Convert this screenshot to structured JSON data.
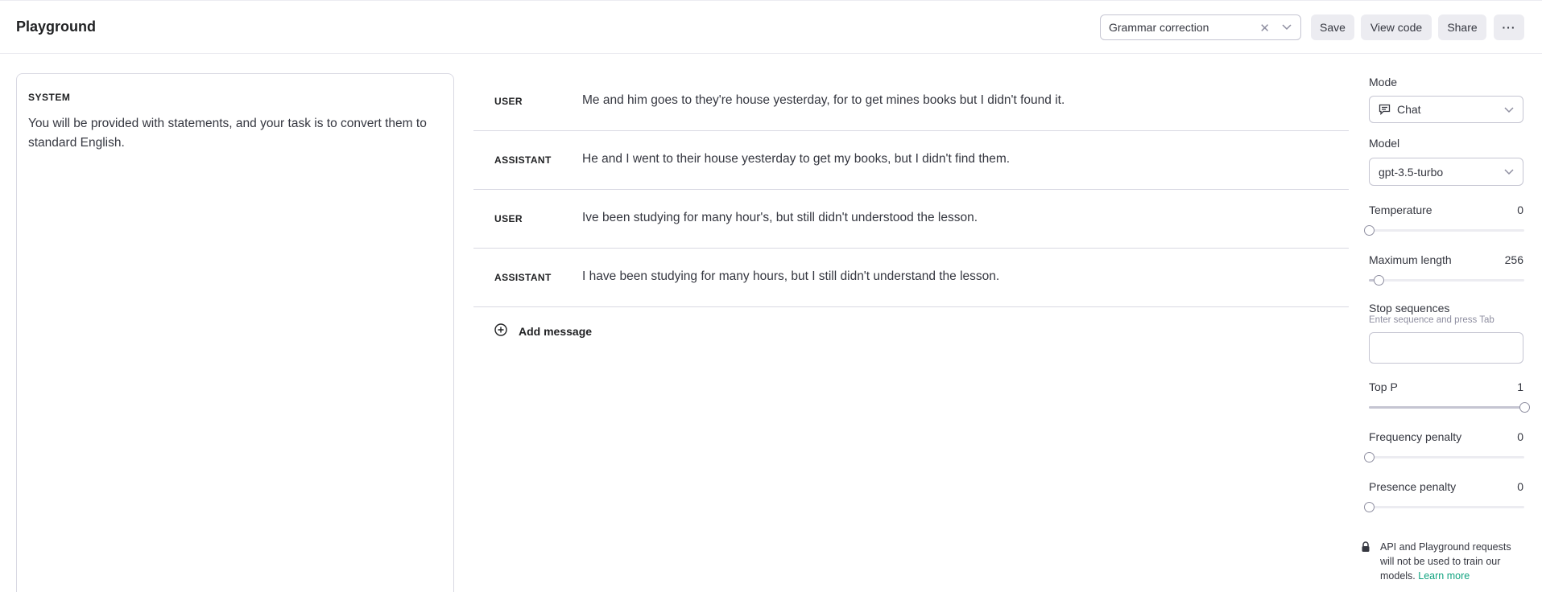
{
  "header": {
    "title": "Playground",
    "preset": "Grammar correction",
    "save_label": "Save",
    "view_code_label": "View code",
    "share_label": "Share",
    "more_label": "···"
  },
  "system": {
    "label": "SYSTEM",
    "text": "You will be provided with statements, and your task is to convert them to standard English."
  },
  "messages": [
    {
      "role": "USER",
      "content": "Me and him goes to they're house yesterday, for to get mines books but I didn't found it."
    },
    {
      "role": "ASSISTANT",
      "content": "He and I went to their house yesterday to get my books, but I didn't find them."
    },
    {
      "role": "USER",
      "content": "Ive been studying for many hour's, but still didn't understood the lesson."
    },
    {
      "role": "ASSISTANT",
      "content": "I have been studying for many hours, but I still didn't understand the lesson."
    }
  ],
  "add_message_label": "Add message",
  "settings": {
    "mode_label": "Mode",
    "mode_value": "Chat",
    "model_label": "Model",
    "model_value": "gpt-3.5-turbo",
    "temperature": {
      "label": "Temperature",
      "value": "0",
      "fraction": 0
    },
    "max_length": {
      "label": "Maximum length",
      "value": "256",
      "fraction": 0.06
    },
    "stop_sequences": {
      "label": "Stop sequences",
      "hint": "Enter sequence and press Tab"
    },
    "top_p": {
      "label": "Top P",
      "value": "1",
      "fraction": 1
    },
    "frequency_penalty": {
      "label": "Frequency penalty",
      "value": "0",
      "fraction": 0
    },
    "presence_penalty": {
      "label": "Presence penalty",
      "value": "0",
      "fraction": 0
    }
  },
  "notice": {
    "text": "API and Playground requests will not be used to train our models.",
    "link": "Learn more"
  },
  "colors": {
    "accent": "#10a37f"
  }
}
